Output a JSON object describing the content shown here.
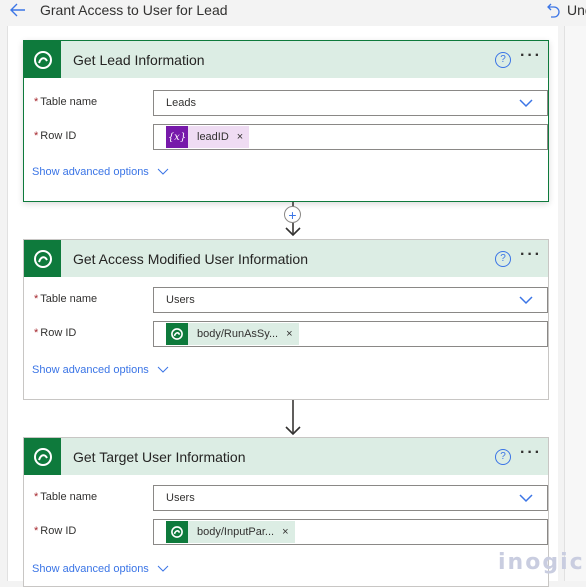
{
  "header": {
    "title": "Grant Access to User for Lead",
    "back_icon": "arrow-left-icon",
    "undo_label": "Undo",
    "undo_icon": "undo-icon"
  },
  "colors": {
    "accent_green": "#0e7a3c",
    "header_green_bg": "#dcede4",
    "link_blue": "#3b75e6",
    "variable_purple": "#7719aa",
    "required_red": "#a4262c"
  },
  "cards": [
    {
      "title": "Get Lead Information",
      "selected": true,
      "fields": [
        {
          "label": "Table name",
          "required": "*",
          "value": "Leads",
          "type": "dropdown"
        },
        {
          "label": "Row ID",
          "required": "*",
          "token": {
            "kind": "variable",
            "icon": "{x}",
            "text": "leadID",
            "remove": "×"
          }
        }
      ],
      "advanced_label": "Show advanced options"
    },
    {
      "title": "Get Access Modified User Information",
      "selected": false,
      "fields": [
        {
          "label": "Table name",
          "required": "*",
          "value": "Users",
          "type": "dropdown"
        },
        {
          "label": "Row ID",
          "required": "*",
          "token": {
            "kind": "dataverse",
            "text": "body/RunAsSy...",
            "remove": "×"
          }
        }
      ],
      "advanced_label": "Show advanced options"
    },
    {
      "title": "Get Target User Information",
      "selected": false,
      "fields": [
        {
          "label": "Table name",
          "required": "*",
          "value": "Users",
          "type": "dropdown"
        },
        {
          "label": "Row ID",
          "required": "*",
          "token": {
            "kind": "dataverse",
            "text": "body/InputPar...",
            "remove": "×"
          }
        }
      ],
      "advanced_label": "Show advanced options"
    }
  ],
  "card_actions": {
    "help": "?",
    "more": "···"
  },
  "connector": {
    "insert_label": "+"
  },
  "watermark": "inogic"
}
